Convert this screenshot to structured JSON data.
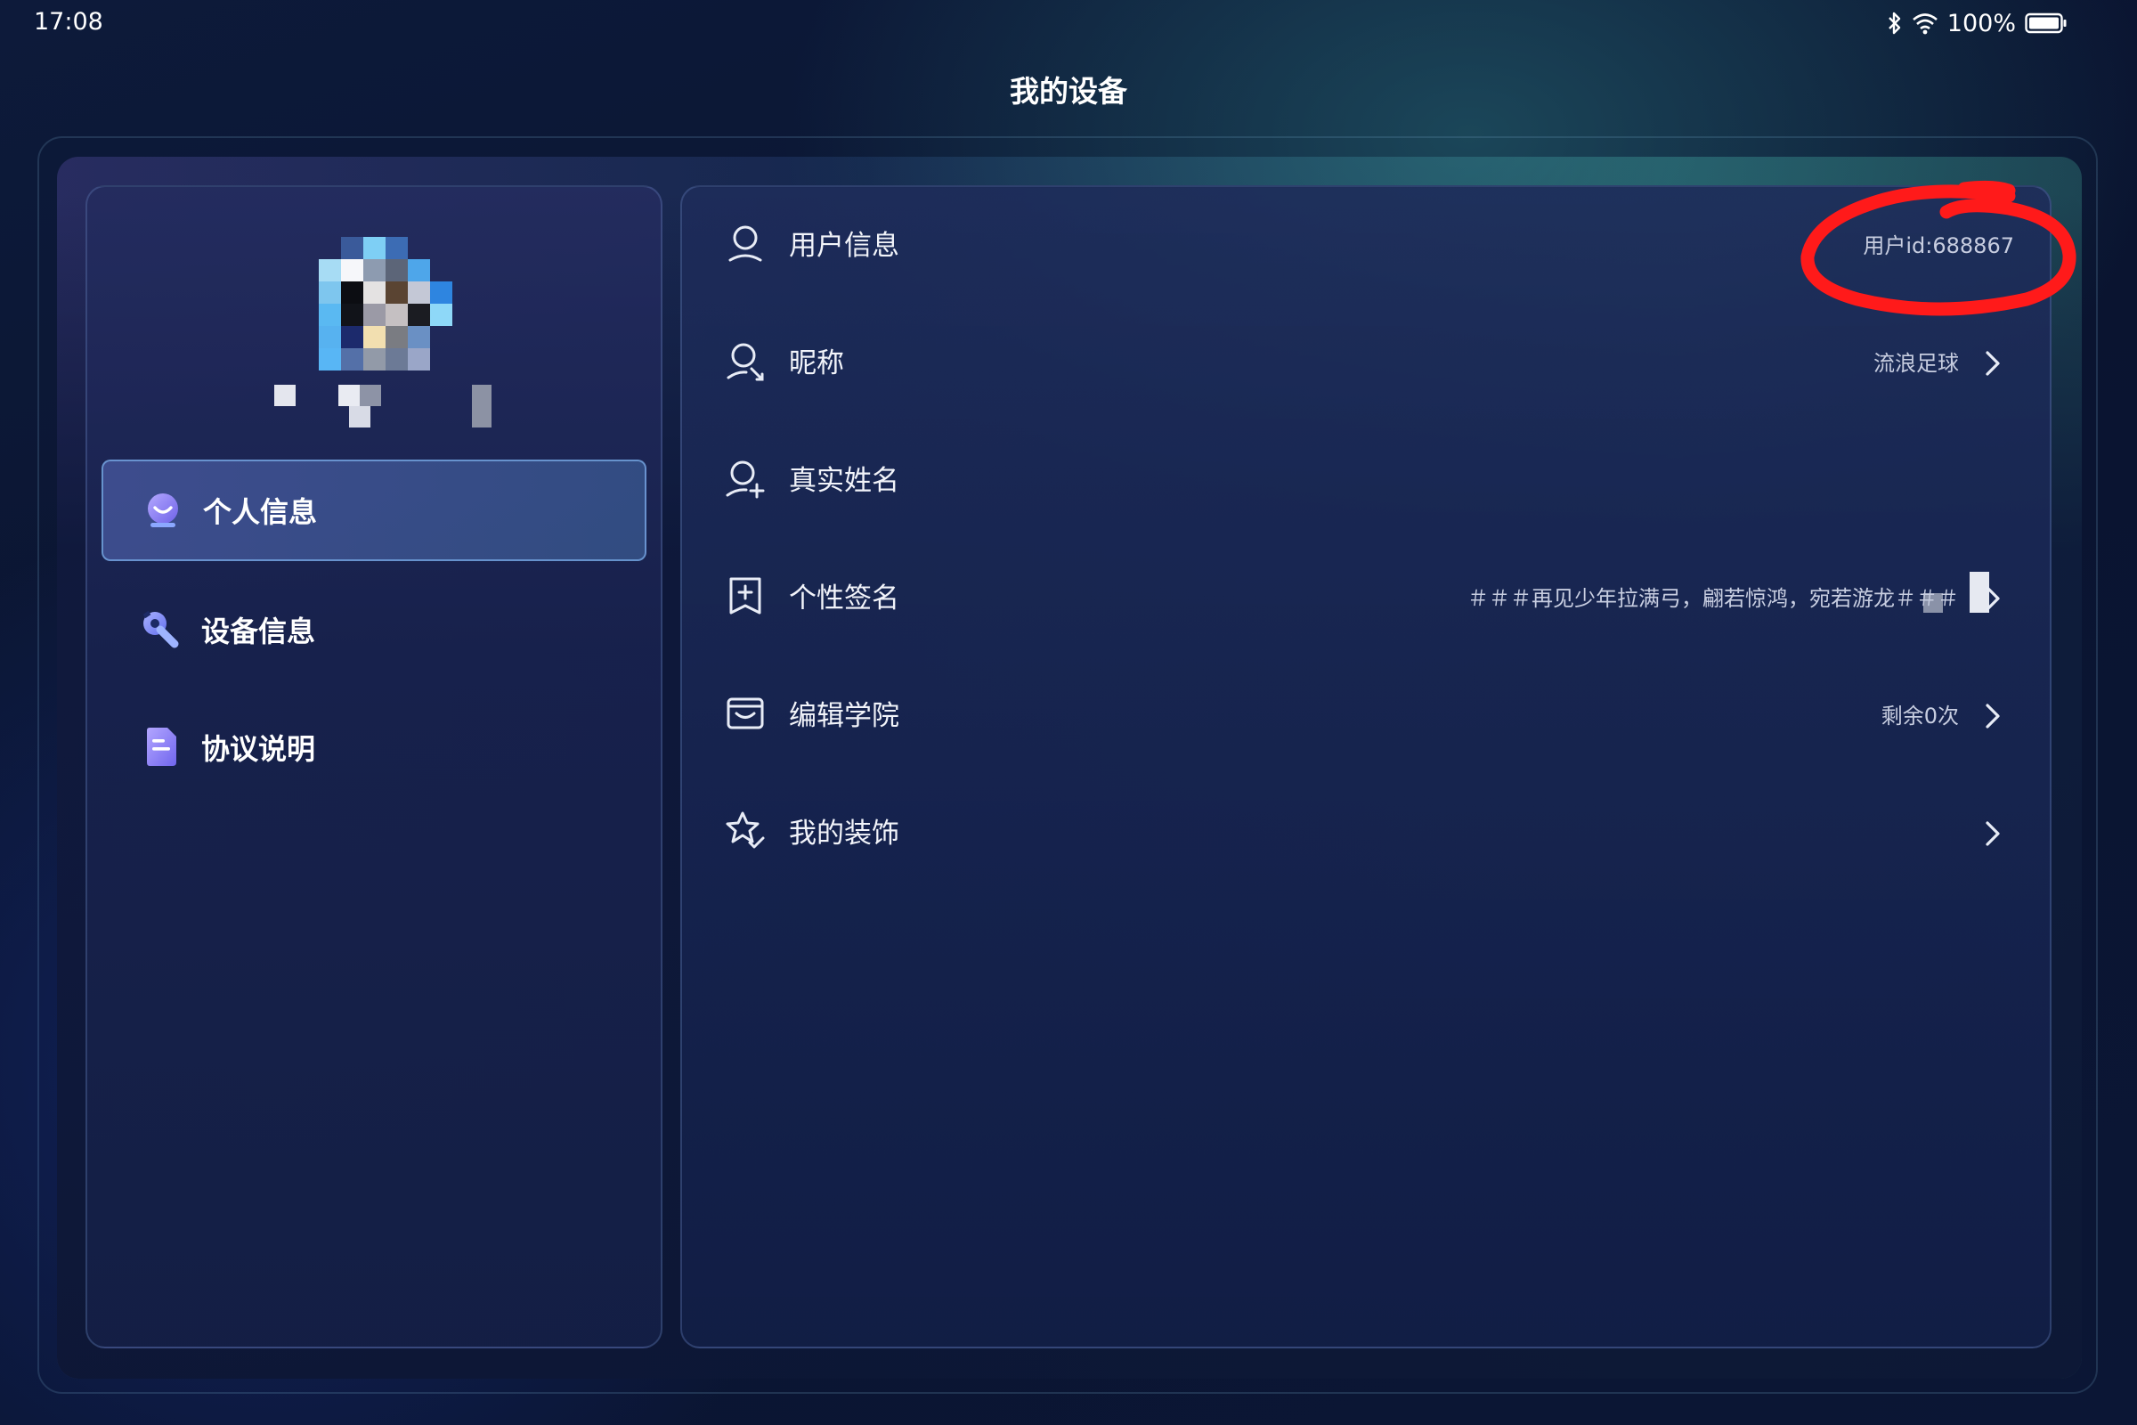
{
  "status_bar": {
    "time": "17:08",
    "battery": "100%",
    "icons": [
      "bluetooth-icon",
      "wifi-icon",
      "battery-icon"
    ]
  },
  "page": {
    "title": "我的设备"
  },
  "sidebar": {
    "items": [
      {
        "label": "个人信息",
        "icon": "profile-icon",
        "active": true
      },
      {
        "label": "设备信息",
        "icon": "wrench-icon",
        "active": false
      },
      {
        "label": "协议说明",
        "icon": "document-icon",
        "active": false
      }
    ]
  },
  "main": {
    "rows": [
      {
        "label": "用户信息",
        "icon": "user-icon",
        "value": "用户id:688867"
      },
      {
        "label": "昵称",
        "icon": "user-edit-icon",
        "value": "流浪足球"
      },
      {
        "label": "真实姓名",
        "icon": "user-add-icon",
        "value": ""
      },
      {
        "label": "个性签名",
        "icon": "signature-icon",
        "value": "＃＃＃再见少年拉满弓，翩若惊鸿，宛若游龙＃＃＃"
      },
      {
        "label": "编辑学院",
        "icon": "academy-icon",
        "value": "剩余0次"
      },
      {
        "label": "我的装饰",
        "icon": "decoration-icon",
        "value": ""
      }
    ]
  },
  "colors": {
    "background": "#0b1633",
    "accent": "#4f9fe6",
    "active_border": "#78aae6",
    "annotation_red": "#ff1a1a"
  }
}
